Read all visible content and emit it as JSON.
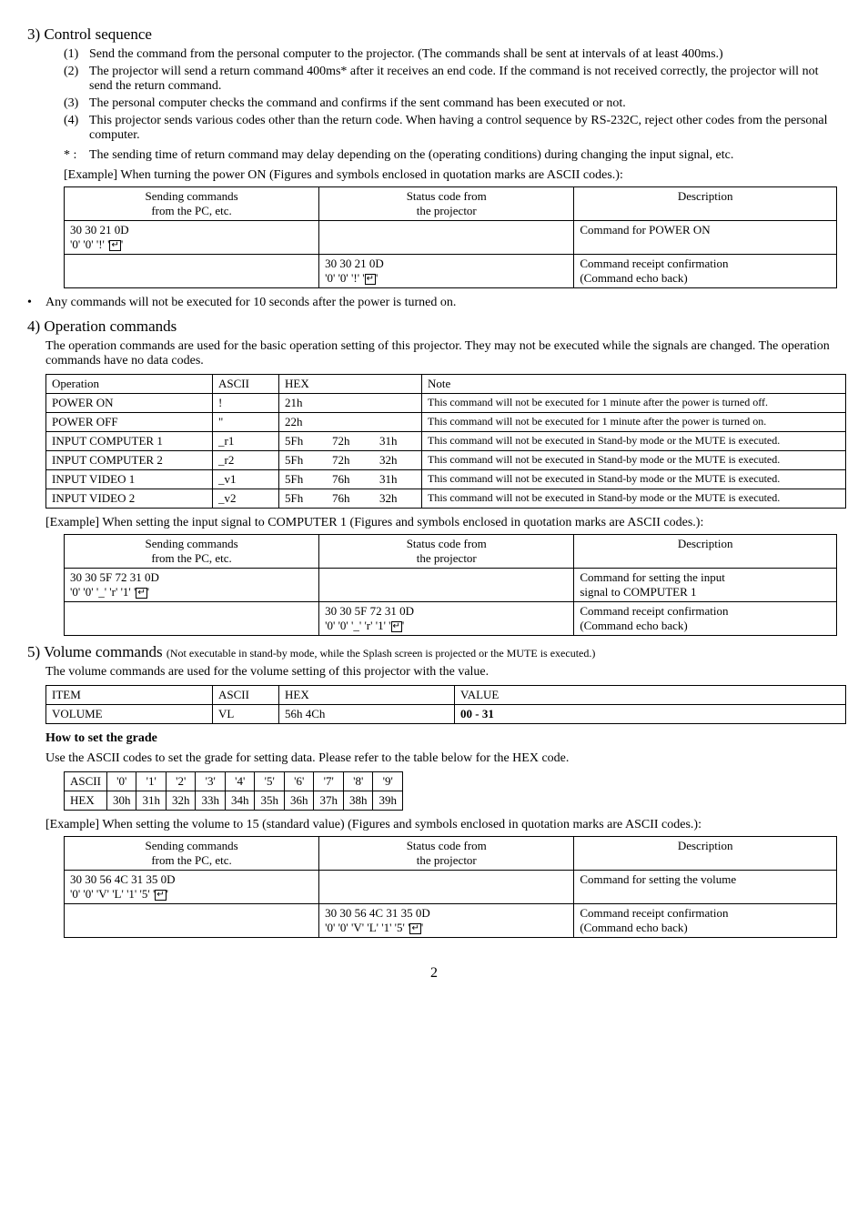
{
  "section3": {
    "heading": "3) Control sequence",
    "items": [
      {
        "n": "(1)",
        "t": "Send the command from the personal computer to the projector. (The commands shall be sent at intervals of at least 400ms.)"
      },
      {
        "n": "(2)",
        "t": "The projector will send a return command 400ms* after it receives an end code. If the command is not received correctly, the projector will not send the return command."
      },
      {
        "n": "(3)",
        "t": "The personal computer checks the command and confirms if the sent command has been executed or not."
      },
      {
        "n": "(4)",
        "t": "This projector sends various codes other than the return code. When having a control sequence by RS-232C, reject other codes from the personal computer."
      }
    ],
    "star": {
      "n": "* :",
      "t": "The sending time of return command may delay depending on the (operating conditions) during changing the input signal, etc."
    },
    "example_label": "[Example]   When turning the power ON (Figures and symbols enclosed in quotation marks are ASCII codes.):",
    "table": {
      "head": [
        "Sending commands from the PC, etc.",
        "Status code from the projector",
        "Description"
      ],
      "rows": [
        {
          "send_hex": "30 30 21 0D",
          "send_ascii": "'0'  '0' '!' ",
          "status": "",
          "desc": "Command for POWER ON"
        },
        {
          "send": "",
          "status_hex": "30 30 21 0D",
          "status_ascii": "'0'  '0' '!' ",
          "desc_a": "Command receipt confirmation",
          "desc_b": "(Command echo back)"
        }
      ]
    },
    "bullet": "Any commands will not be executed for 10 seconds after the power is turned on."
  },
  "section4": {
    "heading": "4) Operation commands",
    "body": "The operation commands are used for the basic operation setting of this projector. They may not be executed while the signals are changed. The operation commands have no data codes.",
    "ops_head": [
      "Operation",
      "ASCII",
      "HEX",
      "",
      "",
      "Note"
    ],
    "ops": [
      {
        "op": "POWER ON",
        "ascii": "!",
        "h1": "21h",
        "h2": "",
        "h3": "",
        "note": "This command will not be executed for 1 minute after the power is turned off."
      },
      {
        "op": "POWER OFF",
        "ascii": "\"",
        "h1": "22h",
        "h2": "",
        "h3": "",
        "note": "This command will not be executed for 1 minute after the power is turned on."
      },
      {
        "op": "INPUT COMPUTER 1",
        "ascii": "_r1",
        "h1": "5Fh",
        "h2": "72h",
        "h3": "31h",
        "note": "This command will not be executed in Stand-by mode or the MUTE is executed."
      },
      {
        "op": "INPUT COMPUTER 2",
        "ascii": "_r2",
        "h1": "5Fh",
        "h2": "72h",
        "h3": "32h",
        "note": "This command will not be executed in Stand-by mode or the MUTE is executed."
      },
      {
        "op": "INPUT VIDEO 1",
        "ascii": "_v1",
        "h1": "5Fh",
        "h2": "76h",
        "h3": "31h",
        "note": "This command will not be executed in Stand-by mode or the MUTE is executed."
      },
      {
        "op": "INPUT VIDEO 2",
        "ascii": "_v2",
        "h1": "5Fh",
        "h2": "76h",
        "h3": "32h",
        "note": "This command will not be executed in Stand-by mode or the MUTE is executed."
      }
    ],
    "example_label": "[Example]   When setting the input signal to COMPUTER 1 (Figures and symbols enclosed in quotation marks are ASCII codes.):",
    "table": {
      "head": [
        "Sending commands from the PC, etc.",
        "Status code from the projector",
        "Description"
      ],
      "rows": [
        {
          "send_hex": "30 30 5F 72 31 0D",
          "send_ascii": "'0' '0' '_' 'r' '1' ",
          "desc_a": "Command for setting the input",
          "desc_b": "signal to COMPUTER 1"
        },
        {
          "status_hex": "30 30 5F 72 31 0D",
          "status_ascii": "'0' '0' '_' 'r' '1' ",
          "desc_a": "Command receipt confirmation",
          "desc_b": "(Command echo back)"
        }
      ]
    }
  },
  "section5": {
    "heading": "5) Volume commands",
    "heading_note": "(Not executable in stand-by mode, while the Splash screen is projected or the MUTE is executed.)",
    "body": "The volume commands are used for the volume setting of this projector with the value.",
    "vol_head": [
      "ITEM",
      "ASCII",
      "HEX",
      "VALUE"
    ],
    "vol_row": {
      "item": "VOLUME",
      "ascii": "VL",
      "hex": "56h    4Ch",
      "value": "00 - 31"
    },
    "grade_heading": "How to set the grade",
    "grade_body": "Use the ASCII codes to set the grade for setting data. Please refer to the table below for the HEX code.",
    "grade_table": {
      "r1": [
        "ASCII",
        "'0'",
        "'1'",
        "'2'",
        "'3'",
        "'4'",
        "'5'",
        "'6'",
        "'7'",
        "'8'",
        "'9'"
      ],
      "r2": [
        "HEX",
        "30h",
        "31h",
        "32h",
        "33h",
        "34h",
        "35h",
        "36h",
        "37h",
        "38h",
        "39h"
      ]
    },
    "example_label": "[Example]   When setting the volume to 15 (standard value) (Figures and symbols enclosed in quotation marks are ASCII codes.):",
    "table": {
      "head": [
        "Sending commands from the PC, etc.",
        "Status code from the projector",
        "Description"
      ],
      "rows": [
        {
          "send_hex": "30 30 56 4C 31 35 0D",
          "send_ascii": "'0' '0' 'V' 'L' '1' '5' ",
          "desc": "Command for setting the volume"
        },
        {
          "status_hex": "30 30 56 4C 31 35 0D",
          "status_ascii": "'0' '0' 'V' 'L' '1' '5' ",
          "desc_a": "Command receipt confirmation",
          "desc_b": "(Command echo back)"
        }
      ]
    }
  },
  "page": "2",
  "enter_symbol": "↵"
}
